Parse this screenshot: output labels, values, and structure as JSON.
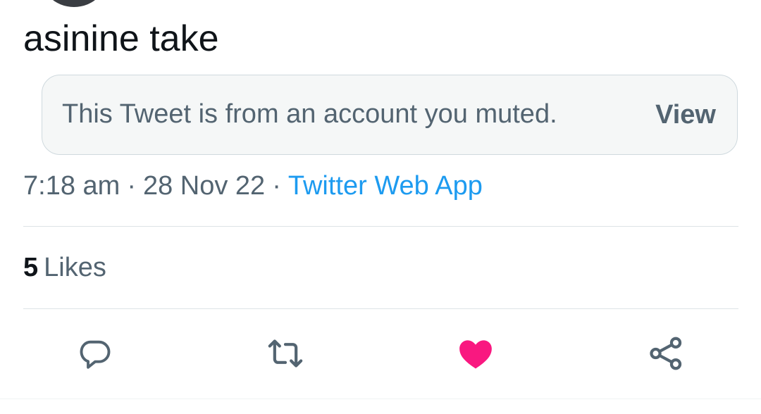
{
  "tweet": {
    "text": "asinine take"
  },
  "muted_notice": {
    "message": "This Tweet is from an account you muted.",
    "view_label": "View"
  },
  "meta": {
    "time": "7:18 am",
    "separator": "·",
    "date": "28 Nov 22",
    "source": "Twitter Web App"
  },
  "stats": {
    "likes_count": "5",
    "likes_label": "Likes"
  },
  "actions": [
    {
      "name": "reply",
      "icon": "reply-icon"
    },
    {
      "name": "retweet",
      "icon": "retweet-icon"
    },
    {
      "name": "like",
      "icon": "heart-icon",
      "active": true
    },
    {
      "name": "share",
      "icon": "share-icon"
    }
  ],
  "colors": {
    "text_primary": "#0f1419",
    "text_secondary": "#536471",
    "link": "#1d9bf0",
    "like_active": "#f91880",
    "muted_box_bg": "#f5f7f7",
    "muted_box_border": "#cfd9de"
  }
}
